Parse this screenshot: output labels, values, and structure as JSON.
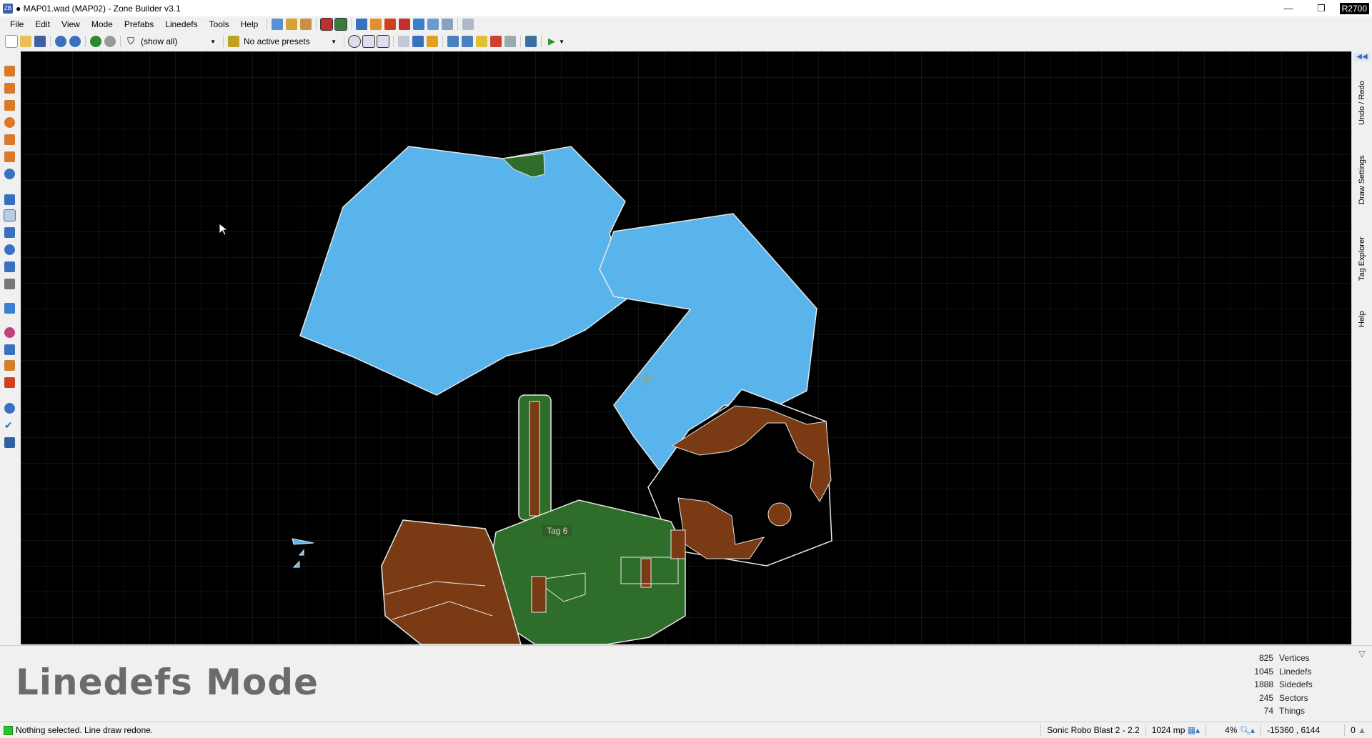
{
  "window": {
    "title": "● MAP01.wad (MAP02) - Zone Builder v3.1",
    "badge": "R2700",
    "minimize": "—",
    "maximize": "❐",
    "close": "✕"
  },
  "menu": [
    "File",
    "Edit",
    "View",
    "Mode",
    "Prefabs",
    "Linedefs",
    "Tools",
    "Help"
  ],
  "toolbar": {
    "filter_value": "(show all)",
    "presets_value": "No active presets"
  },
  "canvas": {
    "tag_label": "Tag 6",
    "colors": {
      "water": "#5ab4ec",
      "grass": "#2f6e2a",
      "dirt": "#7a3b14",
      "background": "#000000",
      "grid": "#1e1e1e",
      "lines": "#e8e8e8"
    }
  },
  "right_tabs": [
    "Undo / Redo",
    "Draw Settings",
    "Tag Explorer",
    "Help"
  ],
  "info": {
    "mode_title": "Linedefs Mode",
    "stats": [
      {
        "value": "825",
        "label": "Vertices"
      },
      {
        "value": "1045",
        "label": "Linedefs"
      },
      {
        "value": "1888",
        "label": "Sidedefs"
      },
      {
        "value": "245",
        "label": "Sectors"
      },
      {
        "value": "74",
        "label": "Things"
      }
    ]
  },
  "status": {
    "message": "Nothing selected. Line draw redone.",
    "game": "Sonic Robo Blast 2 - 2.2",
    "grid": "1024 mp",
    "zoom": "4%",
    "coords": "-15360 , 6144",
    "counter": "0"
  }
}
